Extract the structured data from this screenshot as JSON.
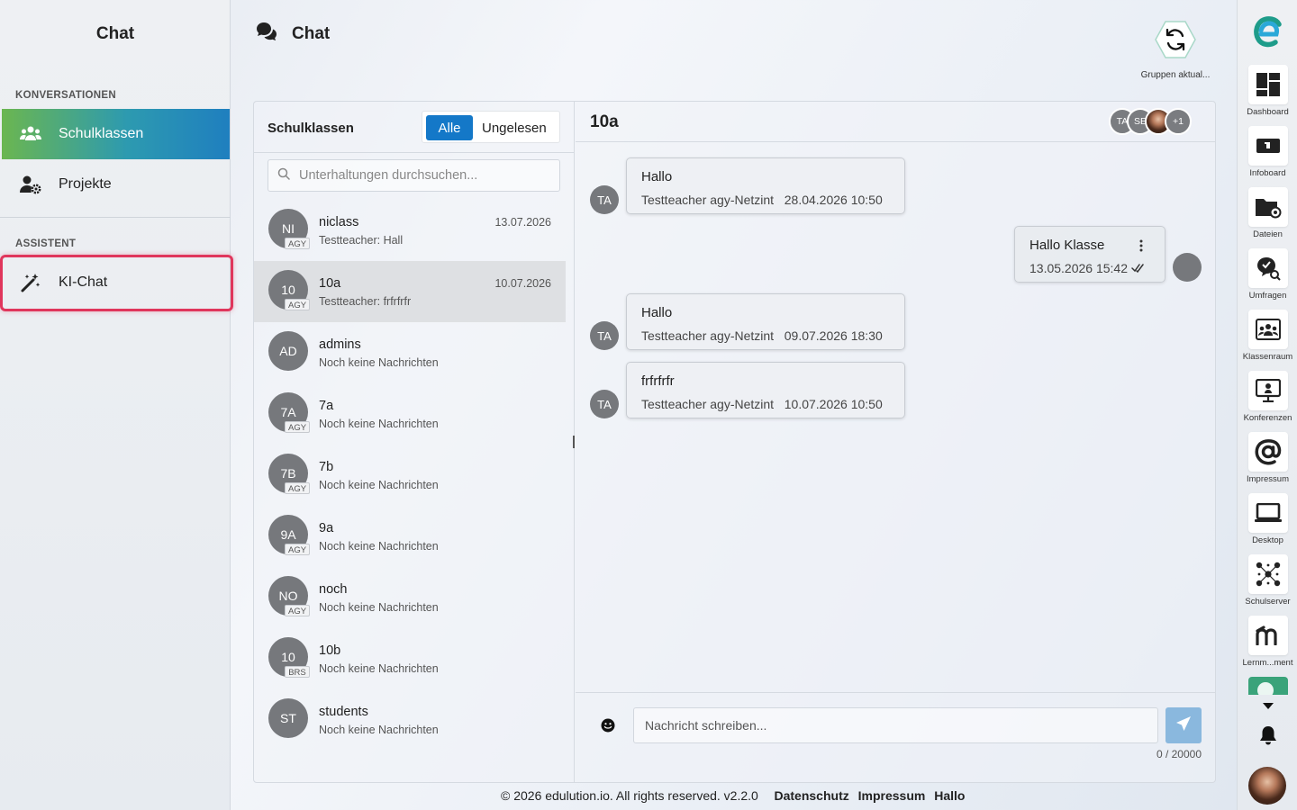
{
  "left_sidebar": {
    "title": "Chat",
    "section_conversations": "KONVERSATIONEN",
    "items": [
      {
        "label": "Schulklassen",
        "icon": "users-icon",
        "active": true
      },
      {
        "label": "Projekte",
        "icon": "user-gear-icon",
        "active": false
      }
    ],
    "section_assistant": "ASSISTENT",
    "assistant_item": {
      "label": "KI-Chat",
      "icon": "magic-wand-icon"
    }
  },
  "header": {
    "title": "Chat",
    "icon": "chat-bubbles-icon"
  },
  "refresh_button": {
    "label": "Gruppen aktual...",
    "icon": "refresh-icon"
  },
  "conversations": {
    "title": "Schulklassen",
    "filter_all": "Alle",
    "filter_unread": "Ungelesen",
    "search_placeholder": "Unterhaltungen durchsuchen...",
    "items": [
      {
        "initials": "NI",
        "tag": "AGY",
        "name": "niclass",
        "subtitle": "Testteacher: Hall",
        "date": "13.07.2026"
      },
      {
        "initials": "10",
        "tag": "AGY",
        "name": "10a",
        "subtitle": "Testteacher: frfrfrfr",
        "date": "10.07.2026"
      },
      {
        "initials": "AD",
        "tag": "",
        "name": "admins",
        "subtitle": "Noch keine Nachrichten",
        "date": ""
      },
      {
        "initials": "7A",
        "tag": "AGY",
        "name": "7a",
        "subtitle": "Noch keine Nachrichten",
        "date": ""
      },
      {
        "initials": "7B",
        "tag": "AGY",
        "name": "7b",
        "subtitle": "Noch keine Nachrichten",
        "date": ""
      },
      {
        "initials": "9A",
        "tag": "AGY",
        "name": "9a",
        "subtitle": "Noch keine Nachrichten",
        "date": ""
      },
      {
        "initials": "NO",
        "tag": "AGY",
        "name": "noch",
        "subtitle": "Noch keine Nachrichten",
        "date": ""
      },
      {
        "initials": "10",
        "tag": "BRS",
        "name": "10b",
        "subtitle": "Noch keine Nachrichten",
        "date": ""
      },
      {
        "initials": "ST",
        "tag": "",
        "name": "students",
        "subtitle": "Noch keine Nachrichten",
        "date": ""
      }
    ]
  },
  "chat": {
    "title": "10a",
    "members": [
      "TA",
      "SE",
      "+1"
    ],
    "messages": [
      {
        "text": "Hallo",
        "sender": "Testteacher agy-Netzint",
        "time": "28.04.2026 10:50",
        "avatar": "TA",
        "own": false
      },
      {
        "text": "Hallo Klasse",
        "sender": "",
        "time": "13.05.2026 15:42",
        "avatar": "",
        "own": true
      },
      {
        "text": "Hallo",
        "sender": "Testteacher agy-Netzint",
        "time": "09.07.2026 18:30",
        "avatar": "TA",
        "own": false
      },
      {
        "text": "frfrfrfr",
        "sender": "Testteacher agy-Netzint",
        "time": "10.07.2026 10:50",
        "avatar": "TA",
        "own": false
      }
    ],
    "input_placeholder": "Nachricht schreiben...",
    "counter": "0 / 20000"
  },
  "right_bar": {
    "items": [
      {
        "label": "Dashboard",
        "icon": "dashboard-icon"
      },
      {
        "label": "Infoboard",
        "icon": "infoboard-icon"
      },
      {
        "label": "Dateien",
        "icon": "folder-icon"
      },
      {
        "label": "Umfragen",
        "icon": "survey-icon"
      },
      {
        "label": "Klassenraum",
        "icon": "classroom-icon"
      },
      {
        "label": "Konferenzen",
        "icon": "conference-icon"
      },
      {
        "label": "Impressum",
        "icon": "at-icon"
      },
      {
        "label": "Desktop",
        "icon": "laptop-icon"
      },
      {
        "label": "Schulserver",
        "icon": "network-icon"
      },
      {
        "label": "Lernm...ment",
        "icon": "moodle-icon"
      }
    ]
  },
  "footer": {
    "copyright": "© 2026 edulution.io. All rights reserved. v2.2.0",
    "links": [
      "Datenschutz",
      "Impressum",
      "Hallo"
    ]
  },
  "colors": {
    "accent": "#1478c8",
    "highlight_border": "#e0365c",
    "gradient_start": "#6bb650",
    "gradient_end": "#1f7fbf"
  }
}
